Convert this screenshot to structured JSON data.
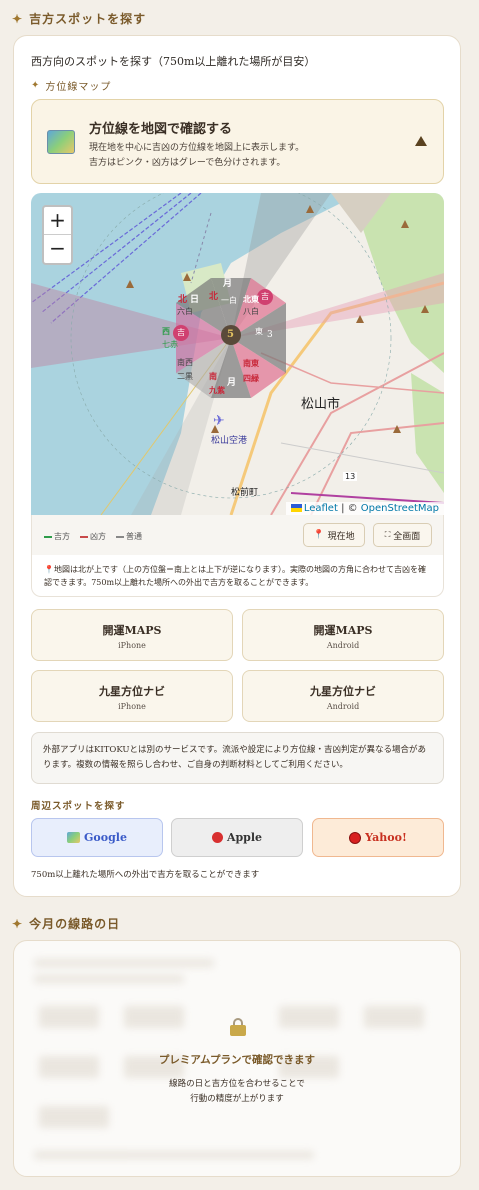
{
  "section1": {
    "title": "吉方スポットを探す"
  },
  "intro": "西方向のスポットを探す（750m以上離れた場所が目安）",
  "map_section": {
    "title": "方位線マップ"
  },
  "banner": {
    "title": "方位線を地図で確認する",
    "line1": "現在地を中心に吉凶の方位線を地図上に表示します。",
    "line2": "吉方はピンク・凶方はグレーで色分けされます。",
    "icon": "map-icon"
  },
  "map": {
    "zoom_in": "+",
    "zoom_out": "−",
    "city_label": "松山市",
    "airport_label": "松山空港",
    "town_label": "松前町",
    "route_label": "13",
    "attribution_leaflet": "Leaflet",
    "attribution_sep": " | © ",
    "attribution_osm": "OpenStreetMap",
    "center_number": "5",
    "sector_labels": {
      "n": "北",
      "n_star": "一白",
      "ne": "北東",
      "ne_star": "八白",
      "e": "東",
      "e_num": "3",
      "se": "南東",
      "se_star": "四緑",
      "s": "南",
      "s_star": "九紫",
      "sw": "南西",
      "sw_star": "二黒",
      "w": "西",
      "w_star": "七赤",
      "nw": "北",
      "nw_star": "六白",
      "lucky": "吉",
      "moon": "月",
      "sun": "日",
      "num_4": "4",
      "num_9": "9",
      "num_2": "2"
    }
  },
  "legend": {
    "good": "吉方",
    "bad": "凶方",
    "normal": "普通"
  },
  "colors": {
    "good": "#2e9c4a",
    "bad": "#c84a4a",
    "normal": "#888888",
    "accent": "#7a5a2a"
  },
  "buttons": {
    "current_location": "現在地",
    "fullscreen": "全画面"
  },
  "note": "地図は北が上です（上の方位盤＝南上とは上下が逆になります）。実際の地図の方角に合わせて吉凶を確認できます。750m以上離れた場所への外出で吉方を取ることができます。",
  "apps": [
    {
      "title": "開運MAPS",
      "platform": "iPhone"
    },
    {
      "title": "開運MAPS",
      "platform": "Android"
    },
    {
      "title": "九星方位ナビ",
      "platform": "iPhone"
    },
    {
      "title": "九星方位ナビ",
      "platform": "Android"
    }
  ],
  "disclaimer": "外部アプリはKITOKUとは別のサービスです。流派や設定により方位線・吉凶判定が異なる場合があります。複数の情報を照らし合わせ、ご自身の判断材料としてご利用ください。",
  "nearby": {
    "title": "周辺スポットを探す"
  },
  "search_buttons": {
    "google": "Google",
    "apple": "Apple",
    "yahoo": "Yahoo!"
  },
  "footer_note": "750m以上離れた場所への外出で吉方を取ることができます",
  "section2": {
    "title": "今月の線路の日"
  },
  "premium": {
    "title": "プレミアムプランで確認できます",
    "line1": "線路の日と吉方位を合わせることで",
    "line2": "行動の精度が上がります"
  }
}
